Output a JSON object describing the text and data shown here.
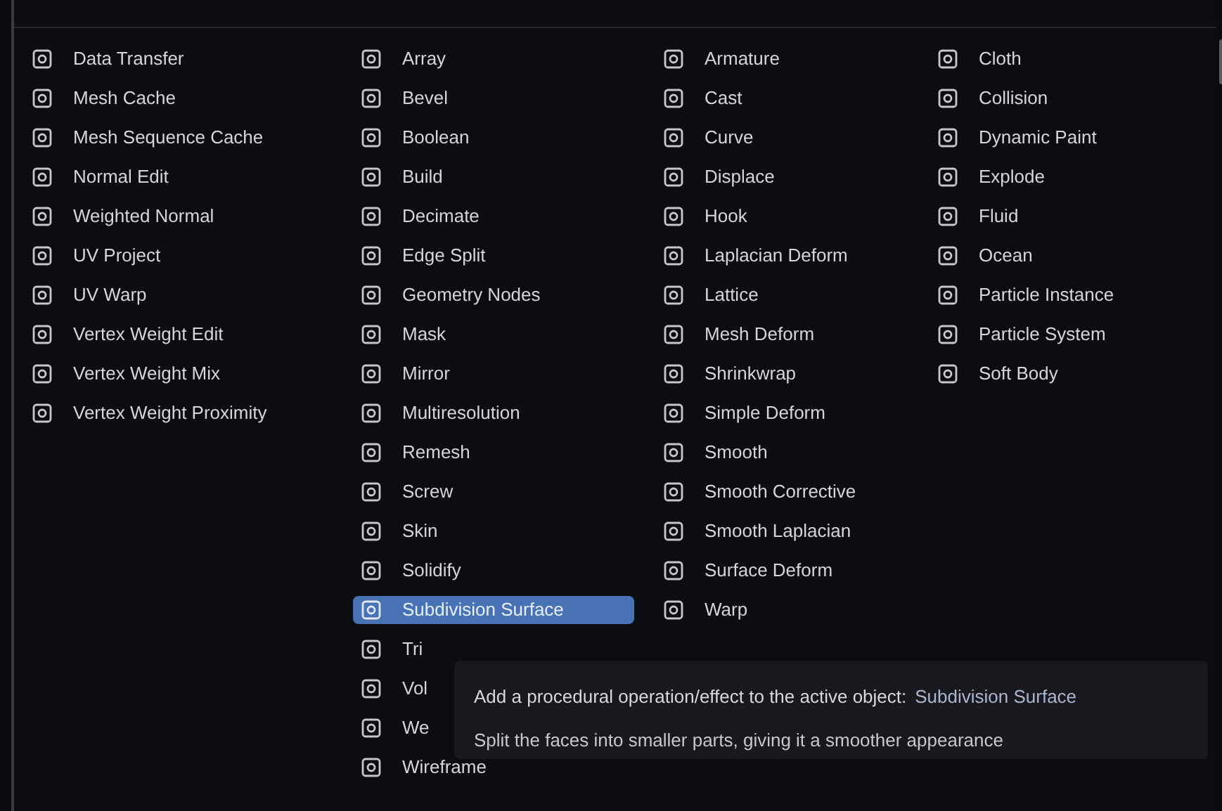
{
  "columns": [
    {
      "items": [
        {
          "label": "Data Transfer",
          "selected": false
        },
        {
          "label": "Mesh Cache",
          "selected": false
        },
        {
          "label": "Mesh Sequence Cache",
          "selected": false
        },
        {
          "label": "Normal Edit",
          "selected": false
        },
        {
          "label": "Weighted Normal",
          "selected": false
        },
        {
          "label": "UV Project",
          "selected": false
        },
        {
          "label": "UV Warp",
          "selected": false
        },
        {
          "label": "Vertex Weight Edit",
          "selected": false
        },
        {
          "label": "Vertex Weight Mix",
          "selected": false
        },
        {
          "label": "Vertex Weight Proximity",
          "selected": false
        }
      ]
    },
    {
      "items": [
        {
          "label": "Array",
          "selected": false
        },
        {
          "label": "Bevel",
          "selected": false
        },
        {
          "label": "Boolean",
          "selected": false
        },
        {
          "label": "Build",
          "selected": false
        },
        {
          "label": "Decimate",
          "selected": false
        },
        {
          "label": "Edge Split",
          "selected": false
        },
        {
          "label": "Geometry Nodes",
          "selected": false
        },
        {
          "label": "Mask",
          "selected": false
        },
        {
          "label": "Mirror",
          "selected": false
        },
        {
          "label": "Multiresolution",
          "selected": false
        },
        {
          "label": "Remesh",
          "selected": false
        },
        {
          "label": "Screw",
          "selected": false
        },
        {
          "label": "Skin",
          "selected": false
        },
        {
          "label": "Solidify",
          "selected": false
        },
        {
          "label": "Subdivision Surface",
          "selected": true
        },
        {
          "label": "Tri",
          "selected": false
        },
        {
          "label": "Vol",
          "selected": false
        },
        {
          "label": "We",
          "selected": false
        },
        {
          "label": "Wireframe",
          "selected": false
        }
      ]
    },
    {
      "items": [
        {
          "label": "Armature",
          "selected": false
        },
        {
          "label": "Cast",
          "selected": false
        },
        {
          "label": "Curve",
          "selected": false
        },
        {
          "label": "Displace",
          "selected": false
        },
        {
          "label": "Hook",
          "selected": false
        },
        {
          "label": "Laplacian Deform",
          "selected": false
        },
        {
          "label": "Lattice",
          "selected": false
        },
        {
          "label": "Mesh Deform",
          "selected": false
        },
        {
          "label": "Shrinkwrap",
          "selected": false
        },
        {
          "label": "Simple Deform",
          "selected": false
        },
        {
          "label": "Smooth",
          "selected": false
        },
        {
          "label": "Smooth Corrective",
          "selected": false
        },
        {
          "label": "Smooth Laplacian",
          "selected": false
        },
        {
          "label": "Surface Deform",
          "selected": false
        },
        {
          "label": "Warp",
          "selected": false
        }
      ]
    },
    {
      "items": [
        {
          "label": "Cloth",
          "selected": false
        },
        {
          "label": "Collision",
          "selected": false
        },
        {
          "label": "Dynamic Paint",
          "selected": false
        },
        {
          "label": "Explode",
          "selected": false
        },
        {
          "label": "Fluid",
          "selected": false
        },
        {
          "label": "Ocean",
          "selected": false
        },
        {
          "label": "Particle Instance",
          "selected": false
        },
        {
          "label": "Particle System",
          "selected": false
        },
        {
          "label": "Soft Body",
          "selected": false
        }
      ]
    }
  ],
  "tooltip": {
    "description": "Add a procedural operation/effect to the active object:",
    "target": "Subdivision Surface",
    "detail": "Split the faces into smaller parts, giving it a smoother appearance"
  }
}
